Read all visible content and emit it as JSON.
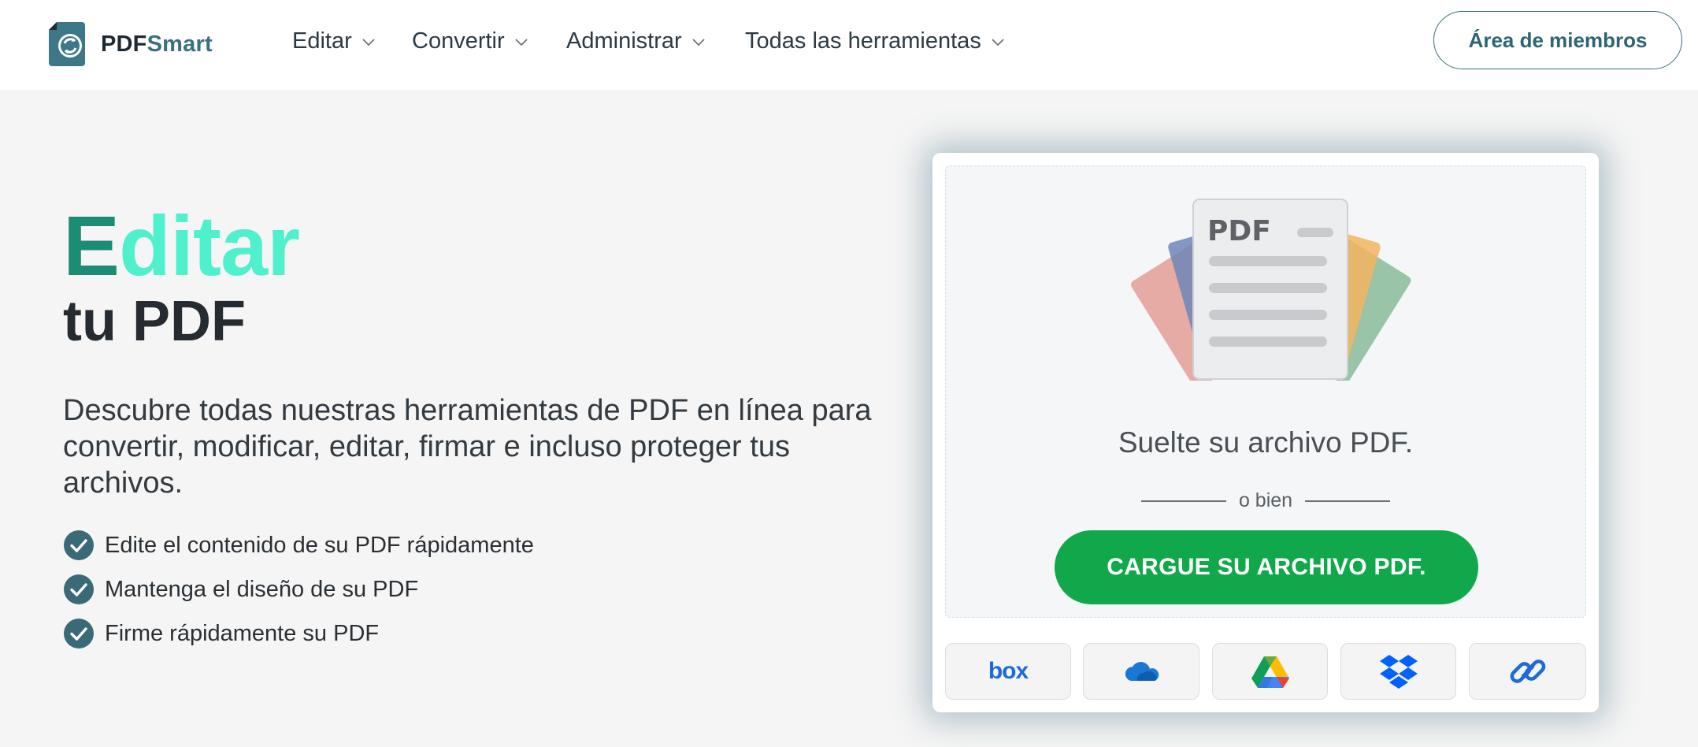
{
  "header": {
    "logo": {
      "part1": "PDF",
      "part2": "Smart"
    },
    "nav": [
      {
        "label": "Editar"
      },
      {
        "label": "Convertir"
      },
      {
        "label": "Administrar"
      },
      {
        "label": "Todas las herramientas"
      }
    ],
    "members_button": "Área de miembros"
  },
  "hero": {
    "title_first_letter": "E",
    "title_rest": "ditar",
    "subtitle": "tu PDF",
    "description": "Descubre todas nuestras herramientas de PDF en línea para convertir, modificar, editar, firmar e incluso proteger tus archivos.",
    "bullets": [
      "Edite el contenido de su PDF rápidamente",
      "Mantenga el diseño de su PDF",
      "Firme rápidamente su PDF"
    ]
  },
  "upload": {
    "illustration_label": "PDF",
    "drop_text": "Suelte su archivo PDF.",
    "or_text": "o bien",
    "upload_button": "CARGUE SU ARCHIVO PDF.",
    "sources": [
      {
        "label": "box",
        "icon": "box-icon"
      },
      {
        "label": "",
        "icon": "onedrive-icon"
      },
      {
        "label": "",
        "icon": "google-drive-icon"
      },
      {
        "label": "",
        "icon": "dropbox-icon"
      },
      {
        "label": "",
        "icon": "link-icon"
      }
    ]
  },
  "colors": {
    "accent_teal": "#3a7080",
    "title_green": "#1d8c74",
    "title_mint": "#4ff0cc",
    "upload_green": "#10a84a",
    "check_color": "#3a6a78"
  }
}
